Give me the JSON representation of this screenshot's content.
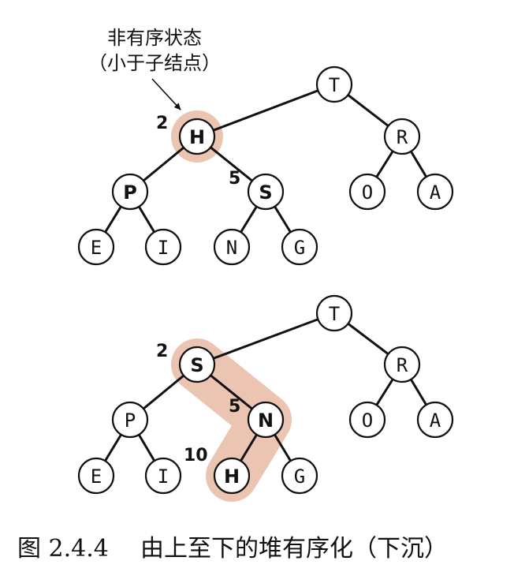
{
  "colors": {
    "highlight": "#ebc5b2",
    "stroke": "#111111",
    "node_fill": "#ffffff"
  },
  "annotation": {
    "line1": "非有序状态",
    "line2": "（小于子结点）"
  },
  "caption": {
    "figure_number": "图 2.4.4",
    "title": "由上至下的堆有序化（下沉）"
  },
  "trees": [
    {
      "name": "before",
      "nodes": [
        {
          "id": "T",
          "label": "T"
        },
        {
          "id": "H",
          "label": "H",
          "bold": true,
          "index": "2"
        },
        {
          "id": "R",
          "label": "R"
        },
        {
          "id": "P",
          "label": "P",
          "bold": true
        },
        {
          "id": "S",
          "label": "S",
          "bold": true,
          "index": "5"
        },
        {
          "id": "O",
          "label": "O"
        },
        {
          "id": "A",
          "label": "A"
        },
        {
          "id": "E",
          "label": "E"
        },
        {
          "id": "I",
          "label": "I"
        },
        {
          "id": "N",
          "label": "N"
        },
        {
          "id": "G",
          "label": "G"
        }
      ],
      "edges": [
        [
          "T",
          "H"
        ],
        [
          "T",
          "R"
        ],
        [
          "H",
          "P"
        ],
        [
          "H",
          "S"
        ],
        [
          "R",
          "O"
        ],
        [
          "R",
          "A"
        ],
        [
          "P",
          "E"
        ],
        [
          "P",
          "I"
        ],
        [
          "S",
          "N"
        ],
        [
          "S",
          "G"
        ]
      ],
      "highlight_path": [
        "H"
      ]
    },
    {
      "name": "after",
      "nodes": [
        {
          "id": "T",
          "label": "T"
        },
        {
          "id": "S",
          "label": "S",
          "bold": true,
          "index": "2"
        },
        {
          "id": "R",
          "label": "R"
        },
        {
          "id": "P",
          "label": "P"
        },
        {
          "id": "N",
          "label": "N",
          "bold": true,
          "index": "5"
        },
        {
          "id": "O",
          "label": "O"
        },
        {
          "id": "A",
          "label": "A"
        },
        {
          "id": "E",
          "label": "E"
        },
        {
          "id": "I",
          "label": "I"
        },
        {
          "id": "H",
          "label": "H",
          "bold": true,
          "index": "10"
        },
        {
          "id": "G",
          "label": "G"
        }
      ],
      "edges": [
        [
          "T",
          "S"
        ],
        [
          "T",
          "R"
        ],
        [
          "S",
          "P"
        ],
        [
          "S",
          "N"
        ],
        [
          "R",
          "O"
        ],
        [
          "R",
          "A"
        ],
        [
          "P",
          "E"
        ],
        [
          "P",
          "I"
        ],
        [
          "N",
          "H"
        ],
        [
          "N",
          "G"
        ]
      ],
      "highlight_path": [
        "S",
        "N",
        "H"
      ]
    }
  ]
}
